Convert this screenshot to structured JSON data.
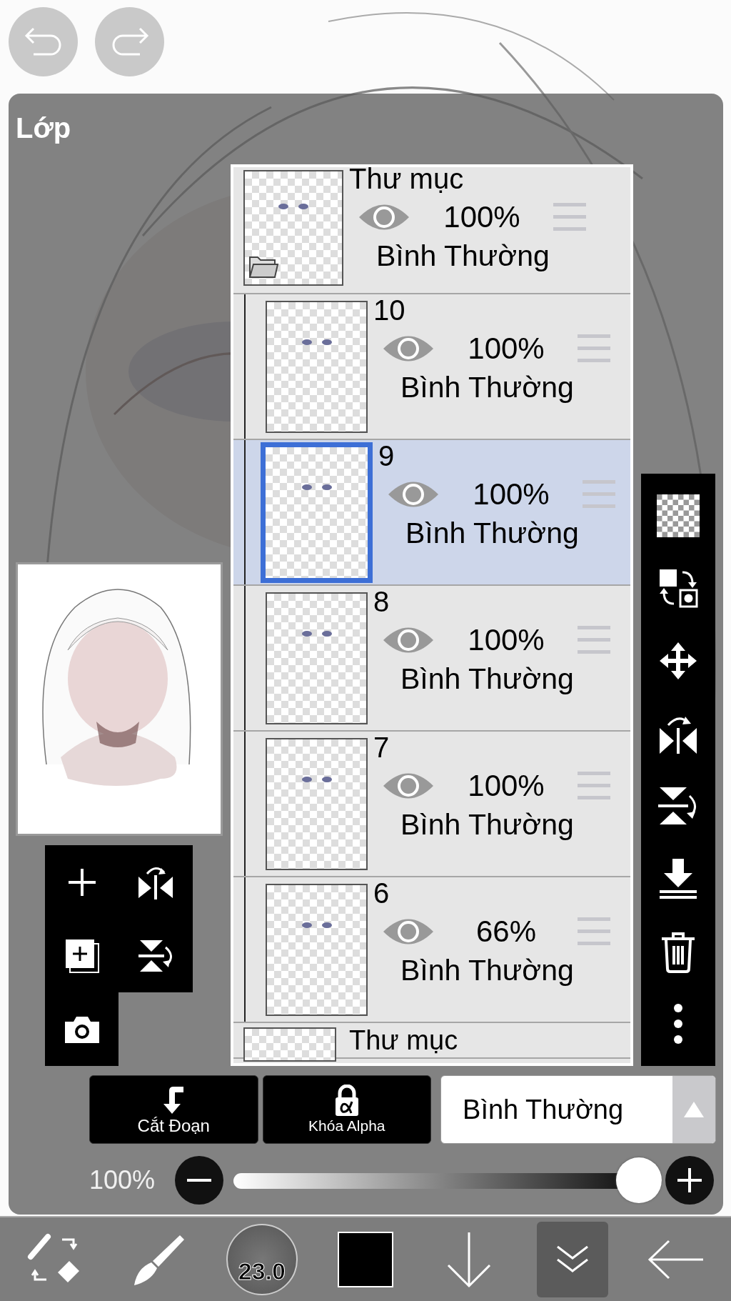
{
  "panel": {
    "title": "Lớp"
  },
  "layers": [
    {
      "kind": "folder",
      "name": "Thư mục",
      "visible": true,
      "opacity": "100%",
      "blend_mode": "Bình Thường",
      "selected": false,
      "children": [
        {
          "kind": "layer",
          "name": "10",
          "visible": true,
          "opacity": "100%",
          "blend_mode": "Bình Thường",
          "selected": false
        },
        {
          "kind": "layer",
          "name": "9",
          "visible": true,
          "opacity": "100%",
          "blend_mode": "Bình Thường",
          "selected": true
        },
        {
          "kind": "layer",
          "name": "8",
          "visible": true,
          "opacity": "100%",
          "blend_mode": "Bình Thường",
          "selected": false
        },
        {
          "kind": "layer",
          "name": "7",
          "visible": true,
          "opacity": "100%",
          "blend_mode": "Bình Thường",
          "selected": false
        },
        {
          "kind": "layer",
          "name": "6",
          "visible": true,
          "opacity": "66%",
          "blend_mode": "Bình Thường",
          "selected": false
        }
      ]
    },
    {
      "kind": "folder",
      "name": "Thư mục",
      "selected": false
    }
  ],
  "layer_buttons": [
    {
      "kind": "clip",
      "label": "Cắt Đoạn"
    },
    {
      "kind": "alpha_lock",
      "label": "Khóa Alpha"
    }
  ],
  "blend_select": {
    "value": "Bình Thường"
  },
  "opacity": {
    "reading": "100%",
    "level": 1
  },
  "toolbar": {
    "brush_size": "23.0"
  }
}
